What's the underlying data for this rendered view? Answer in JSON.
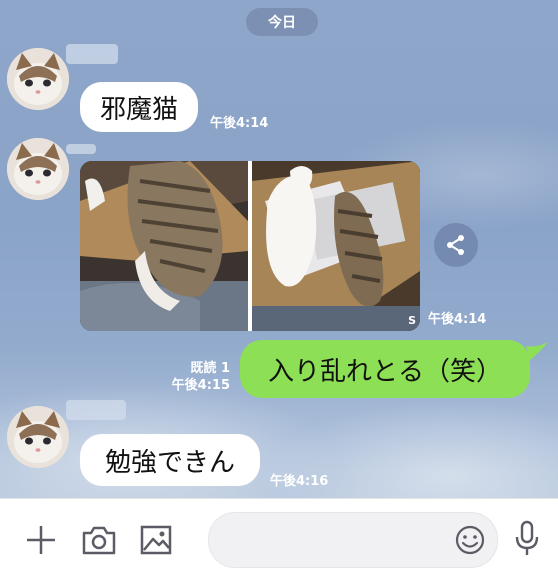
{
  "date_label": "今日",
  "messages": [
    {
      "text": "邪魔猫",
      "time": "午後4:14"
    },
    {
      "photo_time": "午後4:14",
      "watermark": "S"
    },
    {
      "text": "入り乱れとる（笑）",
      "time": "午後4:15",
      "read": "既読 1"
    },
    {
      "text": "勉強できん",
      "time": "午後4:16"
    }
  ],
  "input": {
    "value": "",
    "placeholder": ""
  },
  "icons": [
    "plus-icon",
    "camera-icon",
    "image-icon",
    "emoji-icon",
    "microphone-icon",
    "share-icon"
  ],
  "colors": {
    "sent_bubble": "#8de055",
    "received_bubble": "#ffffff",
    "chat_background": "#8ea6c9"
  }
}
